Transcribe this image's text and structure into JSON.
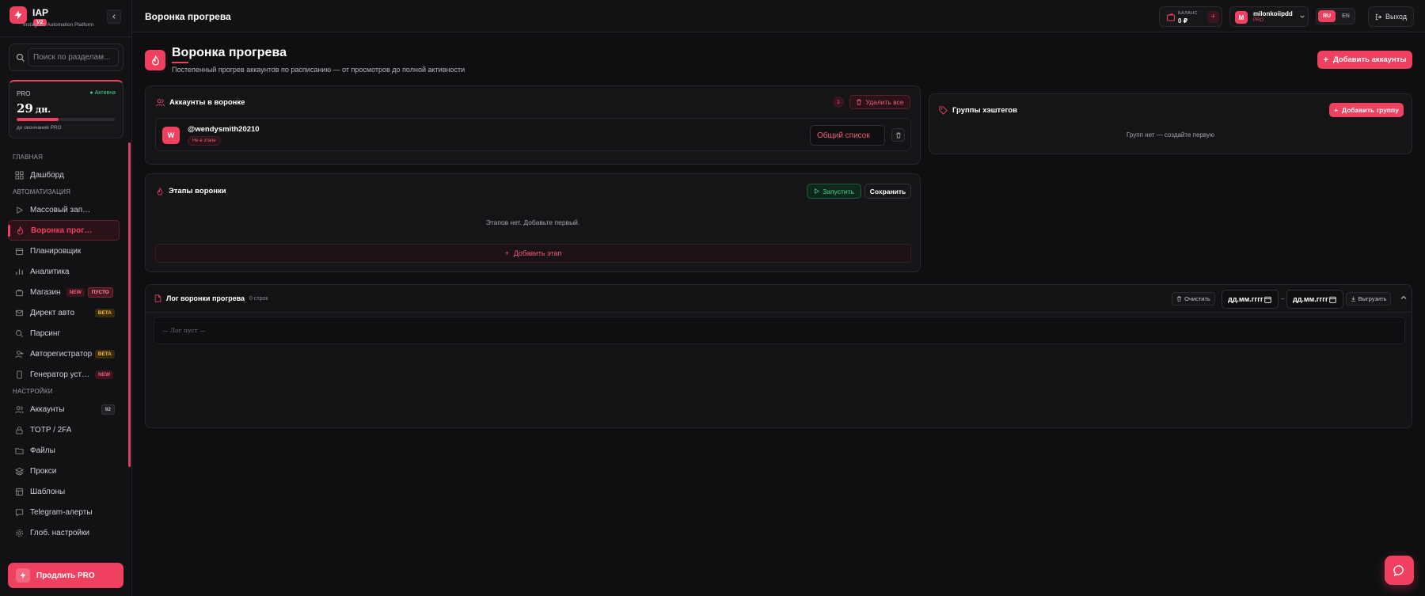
{
  "brand": {
    "name": "IAP",
    "version": "V2",
    "subtitle": "Instagram Automation Platform"
  },
  "search": {
    "placeholder": "Поиск по разделам..."
  },
  "pro": {
    "label": "PRO",
    "status": "Активна",
    "days": "29",
    "days_unit": "дн.",
    "progress_fraction": 0.43,
    "note": "до окончания PRO"
  },
  "nav": {
    "sections": {
      "main": "ГЛАВНАЯ",
      "automation": "АВТОМАТИЗАЦИЯ",
      "settings": "НАСТРОЙКИ"
    },
    "items": {
      "dashboard": "Дашборд",
      "mass_launch": "Массовый запуск",
      "warmup_funnel": "Воронка прогрева",
      "scheduler": "Планировщик",
      "analytics": "Аналитика",
      "shop": "Магазин",
      "direct": "Директ авто",
      "parsing": "Парсинг",
      "autoreg": "Авторегистратор",
      "device_gen": "Генератор устройств",
      "accounts": "Аккаунты",
      "totp": "TOTP / 2FA",
      "files": "Файлы",
      "proxy": "Прокси",
      "templates": "Шаблоны",
      "telegram": "Telegram-алерты",
      "global_settings": "Глоб. настройки"
    },
    "badges": {
      "new": "NEW",
      "empty": "ПУСТО",
      "beta": "BETA",
      "accounts_count": "92"
    }
  },
  "renew": {
    "label": "Продлить PRO"
  },
  "topbar": {
    "title": "Воронка прогрева",
    "balance_label": "БАЛАНС",
    "balance_value": "0 ₽",
    "user_name": "milonkoiipdd",
    "user_initial": "M",
    "user_plan": "PRO",
    "lang_ru": "RU",
    "lang_en": "EN",
    "logout": "Выход"
  },
  "page": {
    "title": "Воронка прогрева",
    "subtitle": "Постепенный прогрев аккаунтов по расписанию — от просмотров до полной активности",
    "add_accounts": "Добавить аккаунты"
  },
  "accounts_card": {
    "title": "Аккаунты в воронке",
    "count": "1",
    "delete_all": "Удалить все",
    "rows": [
      {
        "initial": "W",
        "name": "@wendysmith20210",
        "status": "Не в этапе",
        "list": "Общий список"
      }
    ]
  },
  "stages_card": {
    "title": "Этапы воронки",
    "start": "Запустить",
    "save": "Сохранить",
    "empty": "Этапов нет. Добавьте первый.",
    "add_stage": "Добавить этап"
  },
  "hashtag_card": {
    "title": "Группы хэштегов",
    "add_group": "Добавить группу",
    "empty": "Групп нет — создайте первую"
  },
  "log_card": {
    "title": "Лог воронки прогрева",
    "count": "0 строк",
    "clear": "Очистить",
    "date_from_placeholder": "дд.мм.гггг",
    "date_sep": "–",
    "date_to_placeholder": "дд.мм.гггг",
    "export": "Выгрузить",
    "empty": "— Лог пуст —"
  },
  "colors": {
    "accent": "#f0405f",
    "success": "#3fd38a",
    "beta": "#f0b43a",
    "background": "#0f0f11"
  }
}
